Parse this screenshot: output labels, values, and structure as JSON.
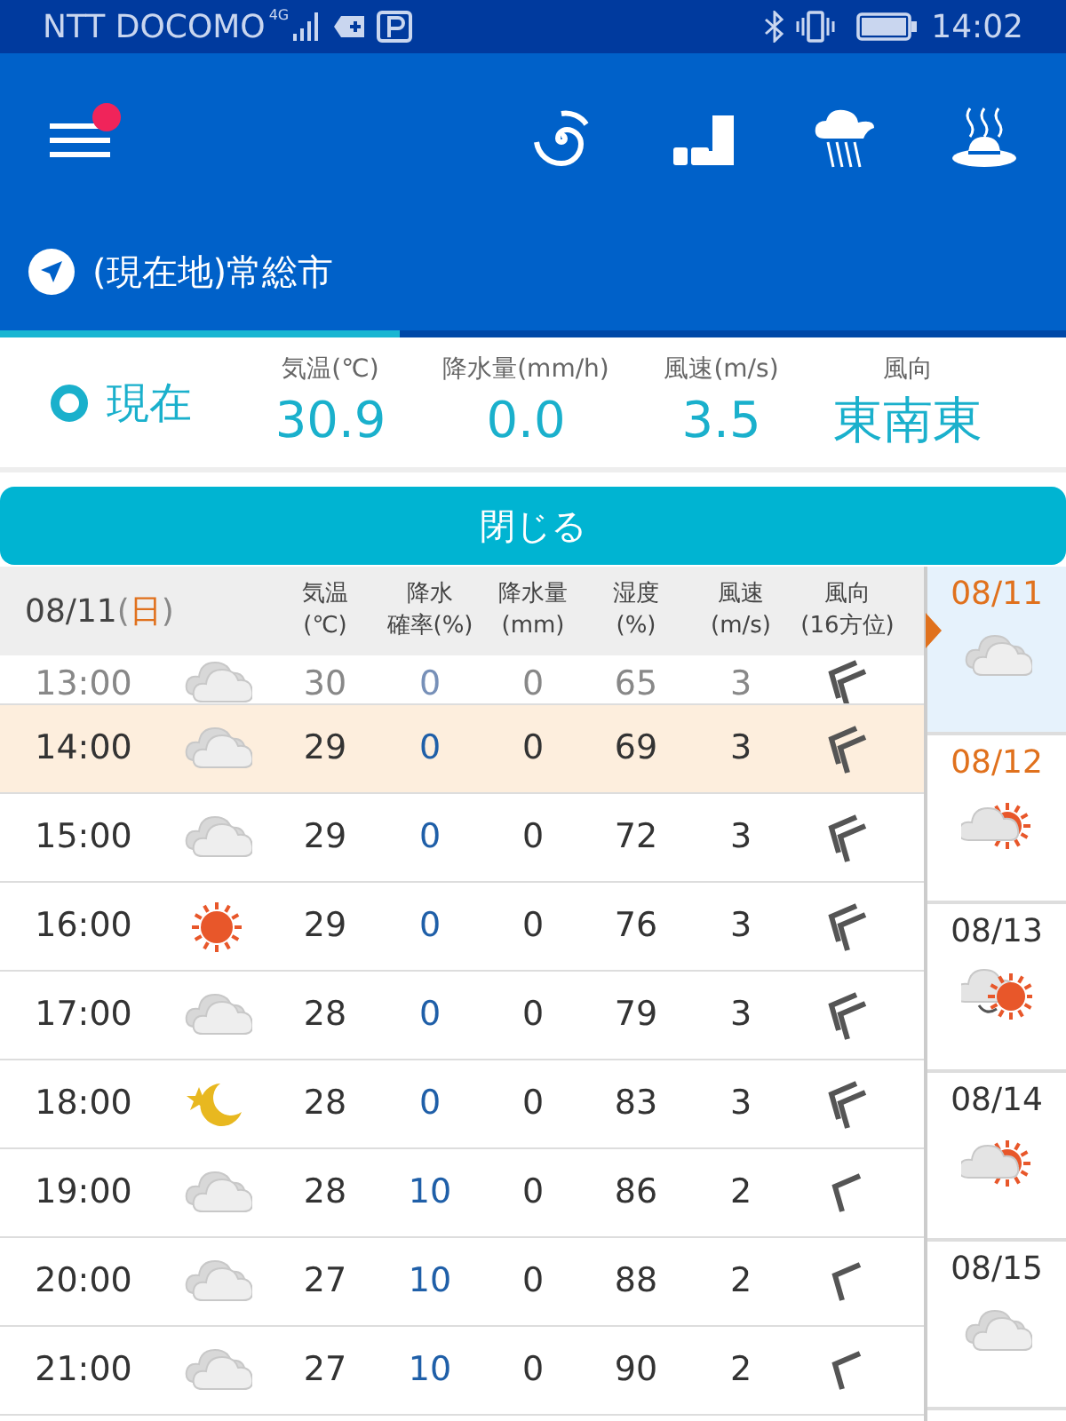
{
  "status_bar": {
    "carrier": "NTT DOCOMO",
    "network": "4G",
    "time": "14:02"
  },
  "app_bar": {
    "menu_badge": true
  },
  "location": {
    "title": "(現在地)常総市"
  },
  "current": {
    "label": "現在",
    "items": [
      {
        "label": "気温(℃)",
        "value": "30.9"
      },
      {
        "label": "降水量(mm/h)",
        "value": "0.0"
      },
      {
        "label": "風速(m/s)",
        "value": "3.5"
      },
      {
        "label": "風向",
        "value": "東南東"
      }
    ]
  },
  "close_button": "閉じる",
  "table": {
    "date": "08/11",
    "weekday_open": "(",
    "weekday": "日",
    "weekday_close": ")",
    "weekday_holiday": true,
    "columns": [
      [
        "気温",
        "(℃)"
      ],
      [
        "降水",
        "確率(%)"
      ],
      [
        "降水量",
        "(mm)"
      ],
      [
        "湿度",
        "(%)"
      ],
      [
        "風速",
        "(m/s)"
      ],
      [
        "風向",
        "(16方位)"
      ]
    ],
    "rows": [
      {
        "time": "13:00",
        "weather": {
          "kind": "cloudy"
        },
        "temp": "30",
        "pop": "0",
        "precip": "0",
        "humidity": "65",
        "wind": "3",
        "wind_icon": {
          "kind": "double"
        },
        "faded": true,
        "selected": false
      },
      {
        "time": "14:00",
        "weather": {
          "kind": "cloudy"
        },
        "temp": "29",
        "pop": "0",
        "precip": "0",
        "humidity": "69",
        "wind": "3",
        "wind_icon": {
          "kind": "double"
        },
        "faded": false,
        "selected": true
      },
      {
        "time": "15:00",
        "weather": {
          "kind": "cloudy"
        },
        "temp": "29",
        "pop": "0",
        "precip": "0",
        "humidity": "72",
        "wind": "3",
        "wind_icon": {
          "kind": "double"
        },
        "faded": false,
        "selected": false
      },
      {
        "time": "16:00",
        "weather": {
          "kind": "sunny"
        },
        "temp": "29",
        "pop": "0",
        "precip": "0",
        "humidity": "76",
        "wind": "3",
        "wind_icon": {
          "kind": "double"
        },
        "faded": false,
        "selected": false
      },
      {
        "time": "17:00",
        "weather": {
          "kind": "cloudy"
        },
        "temp": "28",
        "pop": "0",
        "precip": "0",
        "humidity": "79",
        "wind": "3",
        "wind_icon": {
          "kind": "double"
        },
        "faded": false,
        "selected": false
      },
      {
        "time": "18:00",
        "weather": {
          "kind": "moon"
        },
        "temp": "28",
        "pop": "0",
        "precip": "0",
        "humidity": "83",
        "wind": "3",
        "wind_icon": {
          "kind": "double"
        },
        "faded": false,
        "selected": false
      },
      {
        "time": "19:00",
        "weather": {
          "kind": "cloudy"
        },
        "temp": "28",
        "pop": "10",
        "precip": "0",
        "humidity": "86",
        "wind": "2",
        "wind_icon": {
          "kind": "single"
        },
        "faded": false,
        "selected": false
      },
      {
        "time": "20:00",
        "weather": {
          "kind": "cloudy"
        },
        "temp": "27",
        "pop": "10",
        "precip": "0",
        "humidity": "88",
        "wind": "2",
        "wind_icon": {
          "kind": "single"
        },
        "faded": false,
        "selected": false
      },
      {
        "time": "21:00",
        "weather": {
          "kind": "cloudy"
        },
        "temp": "27",
        "pop": "10",
        "precip": "0",
        "humidity": "90",
        "wind": "2",
        "wind_icon": {
          "kind": "single"
        },
        "faded": false,
        "selected": false
      }
    ]
  },
  "days": [
    {
      "date": "08/11",
      "weather": {
        "kind": "cloudy"
      },
      "holiday": true,
      "selected": true
    },
    {
      "date": "08/12",
      "weather": {
        "kind": "cloud_sun"
      },
      "holiday": true,
      "selected": false
    },
    {
      "date": "08/13",
      "weather": {
        "kind": "cloud_to_sun"
      },
      "holiday": false,
      "selected": false
    },
    {
      "date": "08/14",
      "weather": {
        "kind": "cloud_sun"
      },
      "holiday": false,
      "selected": false
    },
    {
      "date": "08/15",
      "weather": {
        "kind": "cloudy"
      },
      "holiday": false,
      "selected": false
    }
  ]
}
